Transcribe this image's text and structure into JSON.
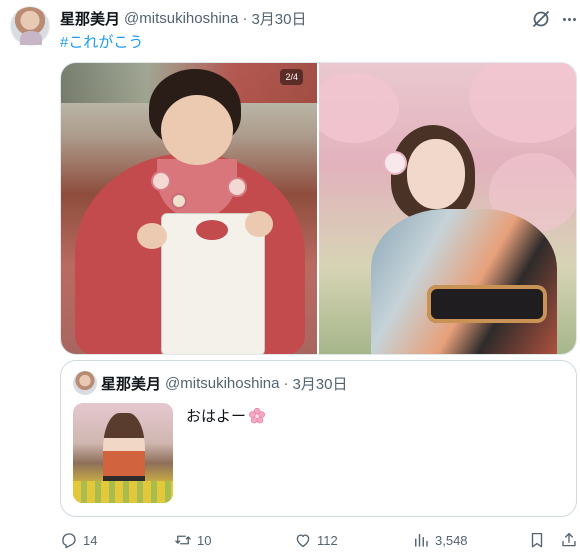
{
  "author": {
    "name": "星那美月",
    "handle": "@mitsukihoshina",
    "separator": "·",
    "date": "3月30日"
  },
  "tweet": {
    "hashtag": "#これがこう"
  },
  "media": {
    "counter_badge": "2/4"
  },
  "quoted": {
    "name": "星那美月",
    "handle": "@mitsukihoshina",
    "separator": "·",
    "date": "3月30日",
    "text": "おはよー"
  },
  "actions": {
    "replies": "14",
    "retweets": "10",
    "likes": "112",
    "views": "3,548"
  },
  "colors": {
    "link": "#1d9bf0",
    "secondary_text": "#536471",
    "primary_text": "#0f1419",
    "border": "#cfd9de"
  },
  "icons": [
    "grok-icon",
    "more-icon",
    "reply-icon",
    "retweet-icon",
    "like-icon",
    "views-icon",
    "bookmark-icon",
    "share-icon",
    "cherry-blossom-icon"
  ]
}
